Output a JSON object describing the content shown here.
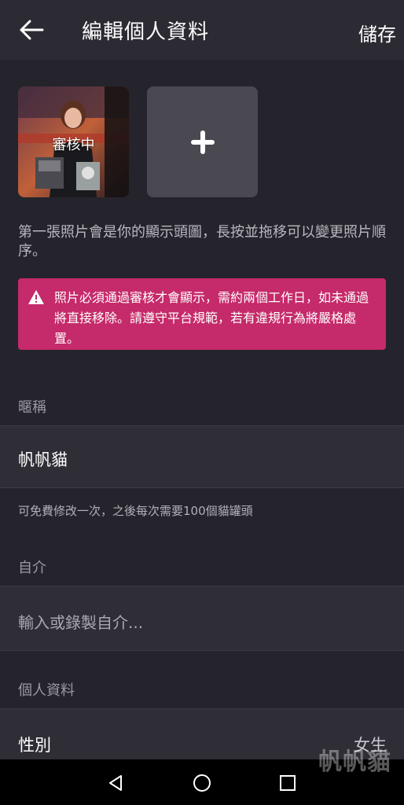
{
  "header": {
    "title": "編輯個人資料",
    "save_label": "儲存"
  },
  "photos": {
    "first_status": "審核中"
  },
  "hint": "第一張照片會是你的顯示頭圖，長按並拖移可以變更照片順序。",
  "warning": "照片必須通過審核才會顯示，需約兩個工作日，如未通過將直接移除。請遵守平台規範，若有違規行為將嚴格處置。",
  "nickname": {
    "label": "暱稱",
    "value": "帆帆貓",
    "note": "可免費修改一次，之後每次需要100個貓罐頭"
  },
  "bio": {
    "label": "自介",
    "placeholder": "輸入或錄製自介..."
  },
  "profile": {
    "label": "個人資料",
    "gender_label": "性別",
    "gender_value": "女生"
  },
  "watermark": "帆帆貓",
  "colors": {
    "background": "#25242c",
    "warning": "#c52a6a",
    "tile": "#4a4951"
  }
}
